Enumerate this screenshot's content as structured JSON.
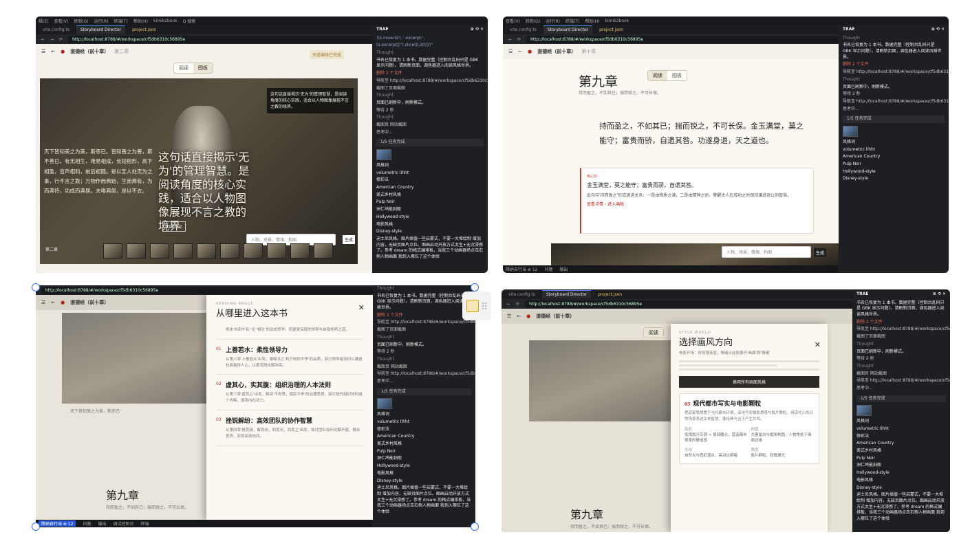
{
  "ide": {
    "menus": [
      "辑(E)",
      "查看(V)",
      "转到(G)",
      "运行(R)",
      "终端(T)",
      "帮助(H)",
      "kimik2book",
      "Q 搜索"
    ],
    "tabs": [
      "vite.config.ts",
      "Storyboard Director",
      "project.json"
    ],
    "url": "http://localhost:8788/#/workspace/cf5db6310c56895e",
    "url_short": "http://localhost:8788/#/workspace/cf5db6310c56895e",
    "status": [
      "降纳自行当 ⊗ 12",
      "问题",
      "输出",
      "调试控制台",
      "终端"
    ]
  },
  "app": {
    "chapter_crumb": "道德经（前十章）",
    "chapter_sub": "第二章",
    "chapter_sub9": "第十章",
    "toggle_read": "阅读",
    "toggle_storyboard": "图板",
    "done_label": "天道编排已完成",
    "hero_left": "天下皆知美之为美，斯恶已。皆知善之为善，斯不善已。有无相生，难易相成，长短相形，高下相盈，音声相和，前后相随。是以圣人处无为之事，行不言之教；万物作而弗始，生而弗有，为而弗恃，功成而弗居。夫唯弗居，是以不去。",
    "hero_quote": "这句话直接揭示'无为'的管理智慧。是阅读角度的核心实践，适合以人物图像展现不言之教的境界",
    "hero_tip": "这句话直接揭示'无为'的管理智慧，是阅读角度的核心实践，适合以人物图像展现不言之教的境界。",
    "back_to_text": "回到原文",
    "chapter_two": "第二章",
    "search_hint": "人物、场景、情绪、构图",
    "search_btn": "生成"
  },
  "chat": {
    "title": "TRAE",
    "lines": [
      "!(s.coverUrl, ' excerpt:',",
      "(s.excerpt||'').slice(0,30)})\"",
      "Thought",
      "书名已恢复为 1 本书。数据完整（控制台乱码只是 GBK 显示问题）。请刷新页面，调色器进入阅读风格世界。",
      "删除 2 个文件",
      "导航至 http://localhost:8788/#/workspace/cf5db6310c560...",
      "截图了页面截图",
      "Thought",
      "页面已刷新中，刷新模式。",
      "等待 2 秒",
      "Thought",
      "截图页 网站截图",
      "导航至 http://localhost:8788/#/workspace/cf5db6310c56895e",
      "思考中..."
    ],
    "task_progress": "1/5 任务完成",
    "prompt_lines": [
      "风格词",
      "volumetric lihht",
      "修彩法",
      "American Country",
      "美式乡村风格",
      "Pulp Noir",
      "洲仁鸠能刻般",
      "Hollywood-style",
      "电影风格",
      "Disney-style",
      "迪士尼风格。图片插值一些启蒙式，不要一大堆绘制 增加内容，无缺页图片点位。图画启动开放方式太生+无沉浸感了。参考 dream 的格式编排板，当我三个动画器场点击右侧人物画面 我到入哪位了这个体验"
    ]
  },
  "doc": {
    "chapter_title": "第九章",
    "chapter_sub": "持而盈之，不如其已；揣而锐之，不可长保。",
    "verse": "持而盈之，不如其已；揣而锐之，不可长保。金玉满堂，莫之能守；富贵而骄，自遗其咎。功遂身退，天之道也。",
    "card_tag": "核心句",
    "card_title": "金玉满堂，莫之能守；富贵而骄，自遗其咎。",
    "card_body": "此句与'持而盈之'形成递进关系：一是由物质之满，二是由精神之骄。警醒世人在成功之时保持谦逊退让的智慧。",
    "card_link": "查看详情 ›  进入画板",
    "search_hint": "人物、场景、情绪、构图",
    "search_btn": "生成"
  },
  "drawer1": {
    "caption": "READING ANGLE",
    "title": "从哪里进入这本书",
    "intro": "将本书读作'有''无''相生'的动态哲学，而是更深层的领导与自我修养之道。",
    "sections": [
      {
        "num": "01",
        "title": "上善若水：柔性领导力",
        "body": "从第八章'上善若水'出发，阐释水之'利万物而不争'的品质，探讨领导者如何以谦逊包容赢得人心，以柔克刚化解冲突。"
      },
      {
        "num": "02",
        "title": "虚其心，实其腹：组织治理的人本法则",
        "body": "从第三章'虚其心'出发，解读'不尚贤，使民不争'的治理思想，探讨现代组织如何减少内耗、激发内在动力。"
      },
      {
        "num": "03",
        "title": "挫锐解纷：高效团队的协作智慧",
        "body": "从第四章'挫其锐，解其纷，和其光，同其尘'出发，探讨团队如何化解矛盾、融合差异、实现高效协同。"
      }
    ],
    "chapter_title": "第九章",
    "chapter_sub": "持而盈之，不如其已；揣而锐之，不可长保。",
    "note": "天下皆知美之为美，斯恶已"
  },
  "drawer2": {
    "caption": "STYLE WORLD",
    "title": "选择画风方向",
    "hint": "电影开场：时间感渐显，情绪从此处展开'画面'即'情绪'",
    "gen_btn": "换用所有画面风格",
    "style_num": "03",
    "style_title": "现代都市写实与电影颗粒",
    "style_body": "把道家思想置于当代都市环境，采用写实摄影质感与胶片颗粒，用现代人的日常场景表达古老智慧，使经典与当下产生共鸣。",
    "cols": [
      {
        "h": "色彩",
        "t": "低饱和冷灰调 + 局部暖光，营造都市夜景的静谧感"
      },
      {
        "h": "构图",
        "t": "大量留白与框架构图，人物常处于画面边缘"
      },
      {
        "h": "光线",
        "t": "自然光与霓虹混合，高对比明暗"
      },
      {
        "h": "质感",
        "t": "胶片颗粒，轻微漏光"
      }
    ],
    "chapter_title": "第九章",
    "chapter_sub": "持而盈之，不如其已；揣而锐之，不可长保。"
  }
}
